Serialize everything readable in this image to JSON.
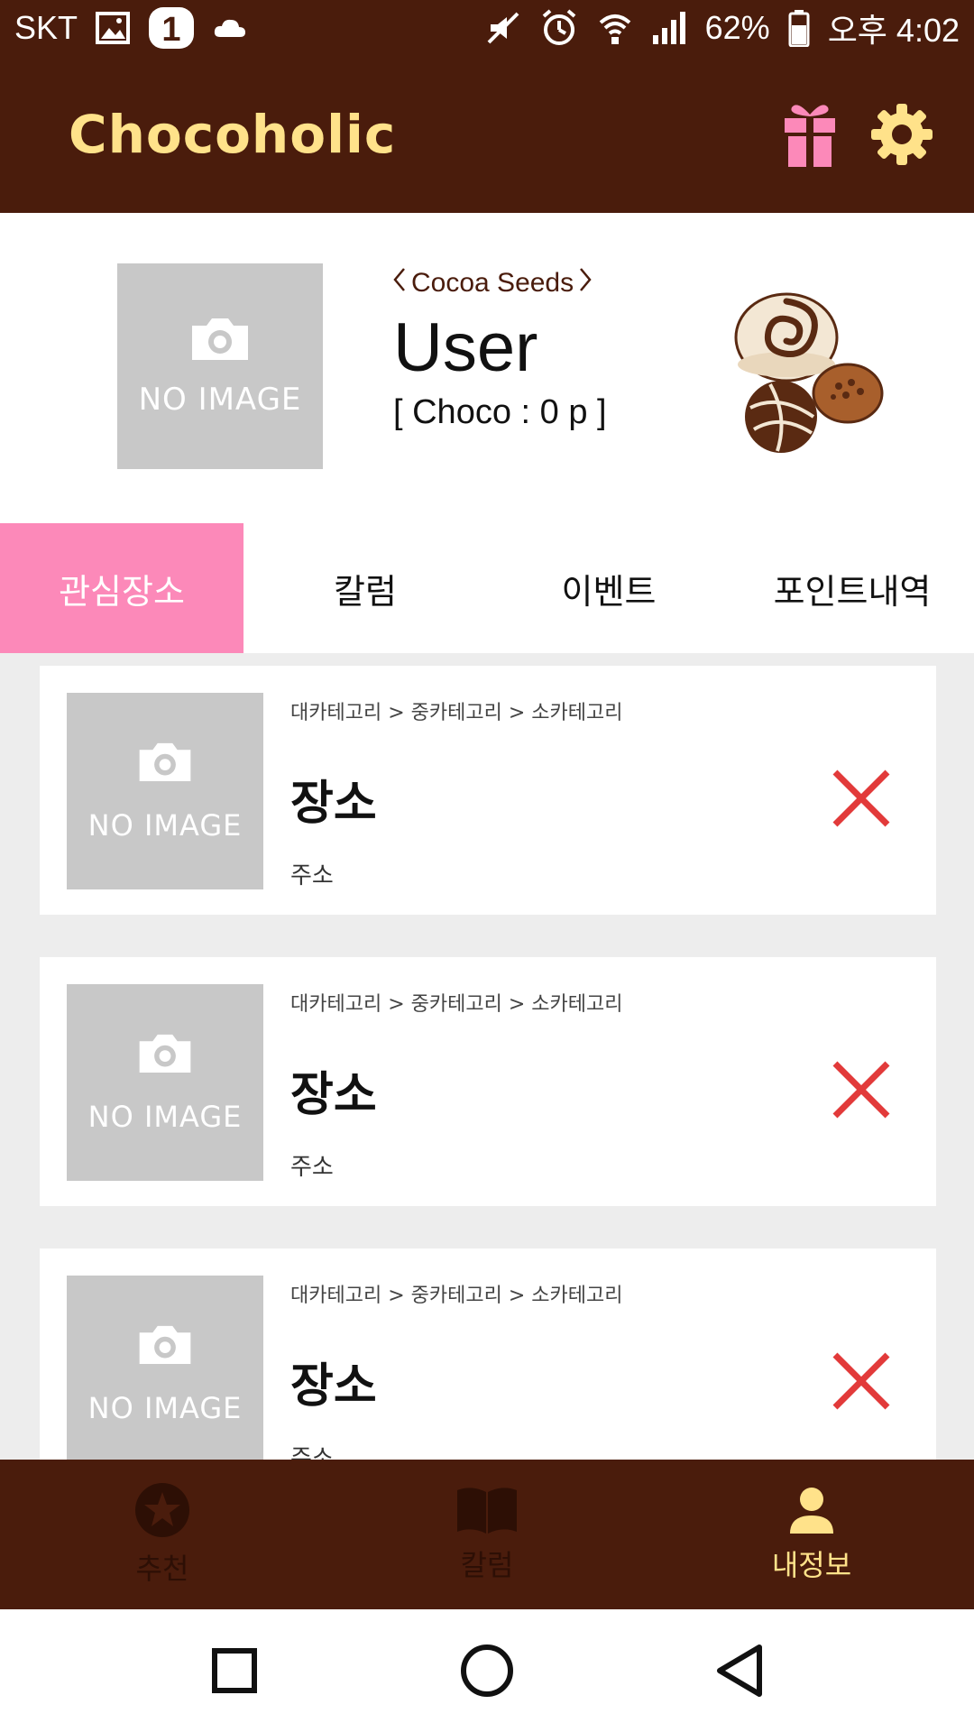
{
  "status_bar": {
    "carrier": "SKT",
    "notification_badge": "1",
    "battery_percent": "62%",
    "time": "오후 4:02",
    "icons": [
      "gallery-icon",
      "one-badge-icon",
      "cloud-icon",
      "mute-icon",
      "alarm-icon",
      "wifi-icon",
      "signal-icon",
      "battery-icon"
    ]
  },
  "app_bar": {
    "title": "Chocoholic",
    "actions": [
      "gift-icon",
      "settings-gear-icon"
    ]
  },
  "profile": {
    "photo_placeholder": "NO IMAGE",
    "grade": "Cocoa Seeds",
    "name": "User",
    "points": "[ Choco : 0 p ]"
  },
  "tabs": [
    {
      "label": "관심장소",
      "active": true
    },
    {
      "label": "칼럼",
      "active": false
    },
    {
      "label": "이벤트",
      "active": false
    },
    {
      "label": "포인트내역",
      "active": false
    }
  ],
  "places": [
    {
      "photo_placeholder": "NO IMAGE",
      "category": "대카테고리 > 중카테고리 > 소카테고리",
      "name": "장소",
      "address": "주소"
    },
    {
      "photo_placeholder": "NO IMAGE",
      "category": "대카테고리 > 중카테고리 > 소카테고리",
      "name": "장소",
      "address": "주소"
    },
    {
      "photo_placeholder": "NO IMAGE",
      "category": "대카테고리 > 중카테고리 > 소카테고리",
      "name": "장소",
      "address": "주소"
    }
  ],
  "bottom_nav": [
    {
      "label": "추천",
      "icon": "star-badge-icon",
      "active": false
    },
    {
      "label": "칼럼",
      "icon": "book-icon",
      "active": false
    },
    {
      "label": "내정보",
      "icon": "person-icon",
      "active": true
    }
  ],
  "system_nav": [
    "recents-square-icon",
    "home-circle-icon",
    "back-triangle-icon"
  ],
  "colors": {
    "brand_brown": "#4a1c0c",
    "title_yellow": "#ffe28a",
    "accent_pink": "#fc89b9",
    "remove_red": "#e23a3a",
    "placeholder_gray": "#c8c8c8",
    "list_background": "#ededed"
  }
}
